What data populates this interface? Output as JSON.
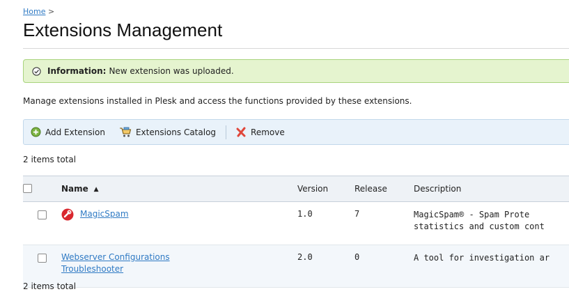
{
  "breadcrumb": {
    "home": "Home",
    "separator": ">"
  },
  "page": {
    "title": "Extensions Management"
  },
  "info": {
    "label": "Information:",
    "message": "New extension was uploaded.",
    "icon": "check-circle-icon",
    "color": "#e5f4cf"
  },
  "intro": "Manage extensions installed in Plesk and access the functions provided by these extensions.",
  "toolbar": {
    "add_label": "Add Extension",
    "catalog_label": "Extensions Catalog",
    "remove_label": "Remove"
  },
  "list": {
    "count_top": "2 items total",
    "count_bottom": "2 items total",
    "columns": {
      "name": "Name",
      "version": "Version",
      "release": "Release",
      "description": "Description"
    },
    "rows": [
      {
        "name": "MagicSpam",
        "icon": "magicspam-icon",
        "version": "1.0",
        "release": "7",
        "description_line1": "MagicSpam® - Spam Prote",
        "description_line2": "statistics and custom cont"
      },
      {
        "name_line1": "Webserver Configurations",
        "name_line2": "Troubleshooter",
        "version": "2.0",
        "release": "0",
        "description_line1": "A tool for investigation ar"
      }
    ]
  },
  "colors": {
    "link": "#2f7ac4",
    "toolbar_bg": "#e9f2fa",
    "header_bg": "#eef2f6"
  }
}
